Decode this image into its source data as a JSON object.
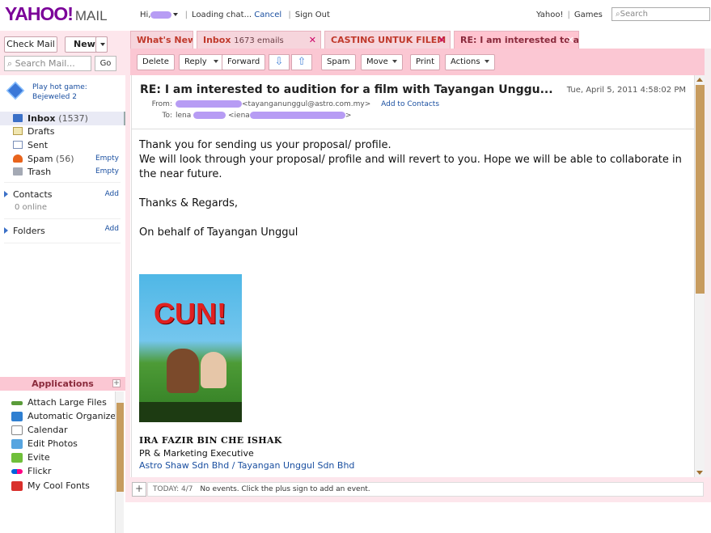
{
  "topbar": {
    "logo_yahoo": "YAHOO!",
    "logo_mail": "MAIL",
    "hi": "Hi,",
    "loading": "Loading chat...",
    "cancel": "Cancel",
    "sign_out": "Sign Out",
    "yahoo_link": "Yahoo!",
    "games_link": "Games",
    "search_placeholder": "Search"
  },
  "tabs": [
    {
      "label": "What's New"
    },
    {
      "label": "Inbox",
      "count": "1673 emails"
    },
    {
      "label": "CASTING UNTUK FILEM '"
    },
    {
      "label": "RE: I am interested to a"
    }
  ],
  "toolbar": {
    "delete": "Delete",
    "reply": "Reply",
    "forward": "Forward",
    "spam": "Spam",
    "move": "Move",
    "print": "Print",
    "actions": "Actions"
  },
  "sidebar": {
    "check_mail": "Check Mail",
    "new": "New",
    "search_placeholder": "Search Mail...",
    "go": "Go",
    "promo_line1": "Play hot game:",
    "promo_line2": "Bejeweled 2",
    "folders": [
      {
        "name": "Inbox",
        "count": "(1537)",
        "action": ""
      },
      {
        "name": "Drafts",
        "count": "",
        "action": ""
      },
      {
        "name": "Sent",
        "count": "",
        "action": ""
      },
      {
        "name": "Spam",
        "count": "(56)",
        "action": "Empty"
      },
      {
        "name": "Trash",
        "count": "",
        "action": "Empty"
      }
    ],
    "contacts": "Contacts",
    "contacts_add": "Add",
    "online": "0 online",
    "folders_label": "Folders",
    "folders_add": "Add",
    "applications": "Applications",
    "apps": [
      "Attach Large Files",
      "Automatic Organizer",
      "Calendar",
      "Edit Photos",
      "Evite",
      "Flickr",
      "My Cool Fonts"
    ]
  },
  "message": {
    "subject": "RE: I am interested to audition for a film with Tayangan Unggu...",
    "date": "Tue, April 5, 2011 4:58:02 PM",
    "from_label": "From:",
    "from_email": "<tayanganunggul@astro.com.my>",
    "add_contacts": "Add to Contacts",
    "to_label": "To:",
    "to_name": "lena",
    "to_prefix": "<iena",
    "to_suffix": ">",
    "body": [
      "Thank you for sending us your proposal/ profile.",
      "We will look through your proposal/ profile and will revert to you.  Hope we will be able to collaborate in the near future.",
      "",
      "Thanks & Regards,",
      "",
      "On behalf of Tayangan Unggul"
    ],
    "poster_title": "CUN!",
    "sig_name": "IRA FAZIR BIN CHE ISHAK",
    "sig_title": "PR & Marketing Executive",
    "sig_company": "Astro Shaw Sdn Bhd / Tayangan Unggul Sdn Bhd"
  },
  "calendar": {
    "today": "TODAY: 4/7",
    "events": "No events. Click the plus sign to add an event."
  }
}
